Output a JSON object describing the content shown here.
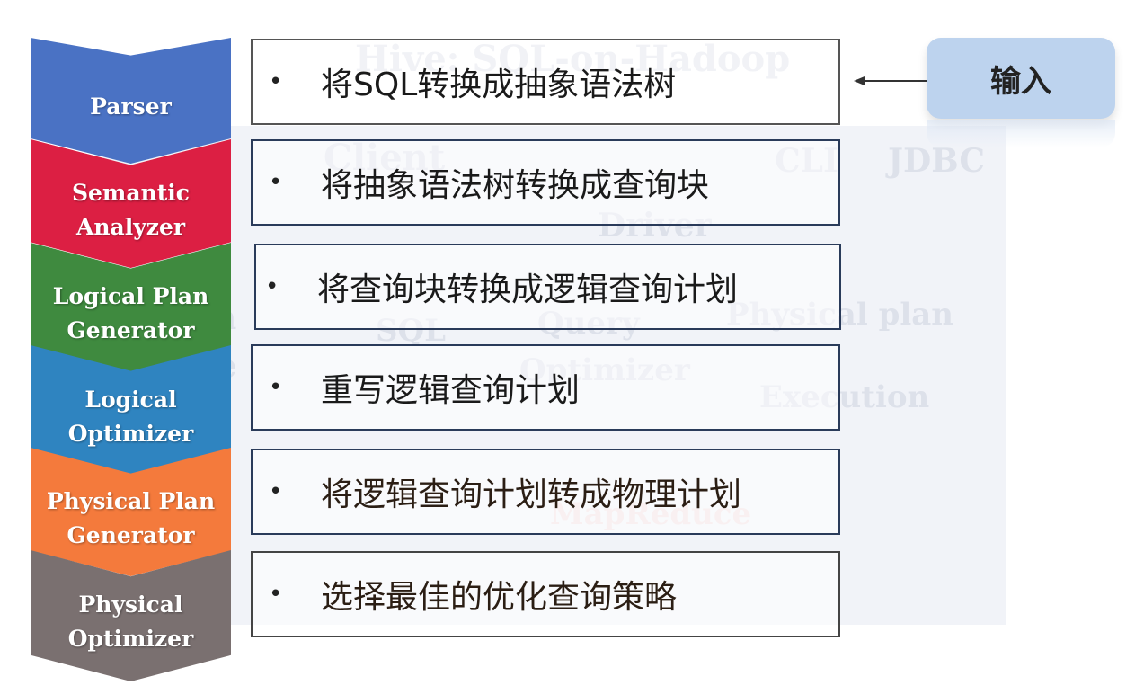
{
  "background": {
    "title": "Hive: SQL-on-Hadoop",
    "client": "Client",
    "cli": "CLI",
    "jdbc": "JDBC",
    "driver": "Driver",
    "meta": "Meta",
    "store": "store",
    "sql": "SQL",
    "query": "Query",
    "optimizer": "Optimizer",
    "physical_plan": "Physical plan",
    "execution": "Execution",
    "mapreduce": "MapReduce"
  },
  "stages": [
    {
      "label": "Parser",
      "color": "#4a72c4",
      "text": "将SQL转换成抽象语法树"
    },
    {
      "label": "Semantic\nAnalyzer",
      "color": "#dc1f43",
      "text": "将抽象语法树转换成查询块"
    },
    {
      "label": "Logical Plan\nGenerator",
      "color": "#3f8a3f",
      "text": "将查询块转换成逻辑查询计划"
    },
    {
      "label": "Logical\nOptimizer",
      "color": "#2f84c0",
      "text": "重写逻辑查询计划"
    },
    {
      "label": "Physical Plan\nGenerator",
      "color": "#f47a3c",
      "text": "将逻辑查询计划转成物理计划"
    },
    {
      "label": "Physical\nOptimizer",
      "color": "#7a7070",
      "text": "选择最佳的优化查询策略"
    }
  ],
  "bullet": "•",
  "input": {
    "label": "输入",
    "color": "#bdd3ee"
  }
}
